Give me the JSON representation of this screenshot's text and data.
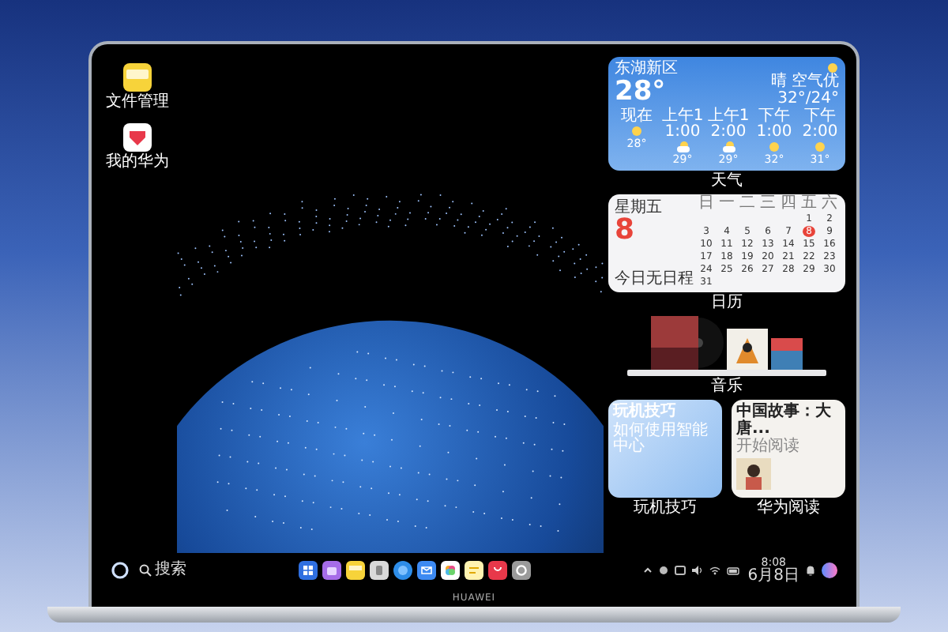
{
  "desktop_icons": [
    {
      "label": "文件管理",
      "kind": "files"
    },
    {
      "label": "我的华为",
      "kind": "myhuawei"
    }
  ],
  "weather": {
    "location": "东湖新区",
    "temperature": "28°",
    "condition": "晴 空气优",
    "range": "32°/24°",
    "label": "天气",
    "hours": [
      {
        "time": "现在",
        "temp": "28°",
        "kind": "sun"
      },
      {
        "time": "上午11:00",
        "temp": "29°",
        "kind": "cloud"
      },
      {
        "time": "上午12:00",
        "temp": "29°",
        "kind": "cloud"
      },
      {
        "time": "下午1:00",
        "temp": "32°",
        "kind": "sun"
      },
      {
        "time": "下午2:00",
        "temp": "31°",
        "kind": "sun"
      }
    ]
  },
  "calendar": {
    "weekday": "星期五",
    "day": "8",
    "note": "今日无日程",
    "label": "日历",
    "weekdays": [
      "日",
      "一",
      "二",
      "三",
      "四",
      "五",
      "六"
    ],
    "weeks": [
      [
        {
          "d": "1",
          "selected": false
        },
        {
          "d": "2",
          "selected": false
        }
      ],
      [
        {
          "d": "3",
          "selected": false
        },
        {
          "d": "4",
          "selected": false
        },
        {
          "d": "5",
          "selected": false
        },
        {
          "d": "6",
          "selected": false
        },
        {
          "d": "7",
          "selected": false
        },
        {
          "d": "8",
          "selected": true
        },
        {
          "d": "9",
          "selected": false
        }
      ],
      [
        {
          "d": "10",
          "selected": false
        },
        {
          "d": "11",
          "selected": false
        },
        {
          "d": "12",
          "selected": false
        },
        {
          "d": "13",
          "selected": false
        },
        {
          "d": "14",
          "selected": false
        },
        {
          "d": "15",
          "selected": false
        },
        {
          "d": "16",
          "selected": false
        }
      ],
      [
        {
          "d": "17",
          "selected": false
        },
        {
          "d": "18",
          "selected": false
        },
        {
          "d": "19",
          "selected": false
        },
        {
          "d": "20",
          "selected": false
        },
        {
          "d": "21",
          "selected": false
        },
        {
          "d": "22",
          "selected": false
        },
        {
          "d": "23",
          "selected": false
        }
      ],
      [
        {
          "d": "24",
          "selected": false
        },
        {
          "d": "25",
          "selected": false
        },
        {
          "d": "26",
          "selected": false
        },
        {
          "d": "27",
          "selected": false
        },
        {
          "d": "28",
          "selected": false
        },
        {
          "d": "29",
          "selected": false
        },
        {
          "d": "30",
          "selected": false
        }
      ],
      [
        {
          "d": "31",
          "selected": false
        }
      ]
    ]
  },
  "music": {
    "label": "音乐"
  },
  "tiles": [
    {
      "kind": "tips",
      "title": "玩机技巧",
      "subtitle": "如何使用智能中心",
      "label": "玩机技巧"
    },
    {
      "kind": "reading",
      "title": "中国故事：大唐...",
      "subtitle": "开始阅读",
      "label": "华为阅读"
    }
  ],
  "taskbar": {
    "search": "搜索",
    "apps": [
      {
        "kind": "grid"
      },
      {
        "kind": "notes"
      },
      {
        "kind": "folder"
      },
      {
        "kind": "trash"
      },
      {
        "kind": "browser"
      },
      {
        "kind": "mail"
      },
      {
        "kind": "gallery"
      },
      {
        "kind": "memo"
      },
      {
        "kind": "shop"
      },
      {
        "kind": "settings"
      }
    ],
    "time": "8:08",
    "date": "6月8日"
  },
  "brand": "HUAWEI"
}
